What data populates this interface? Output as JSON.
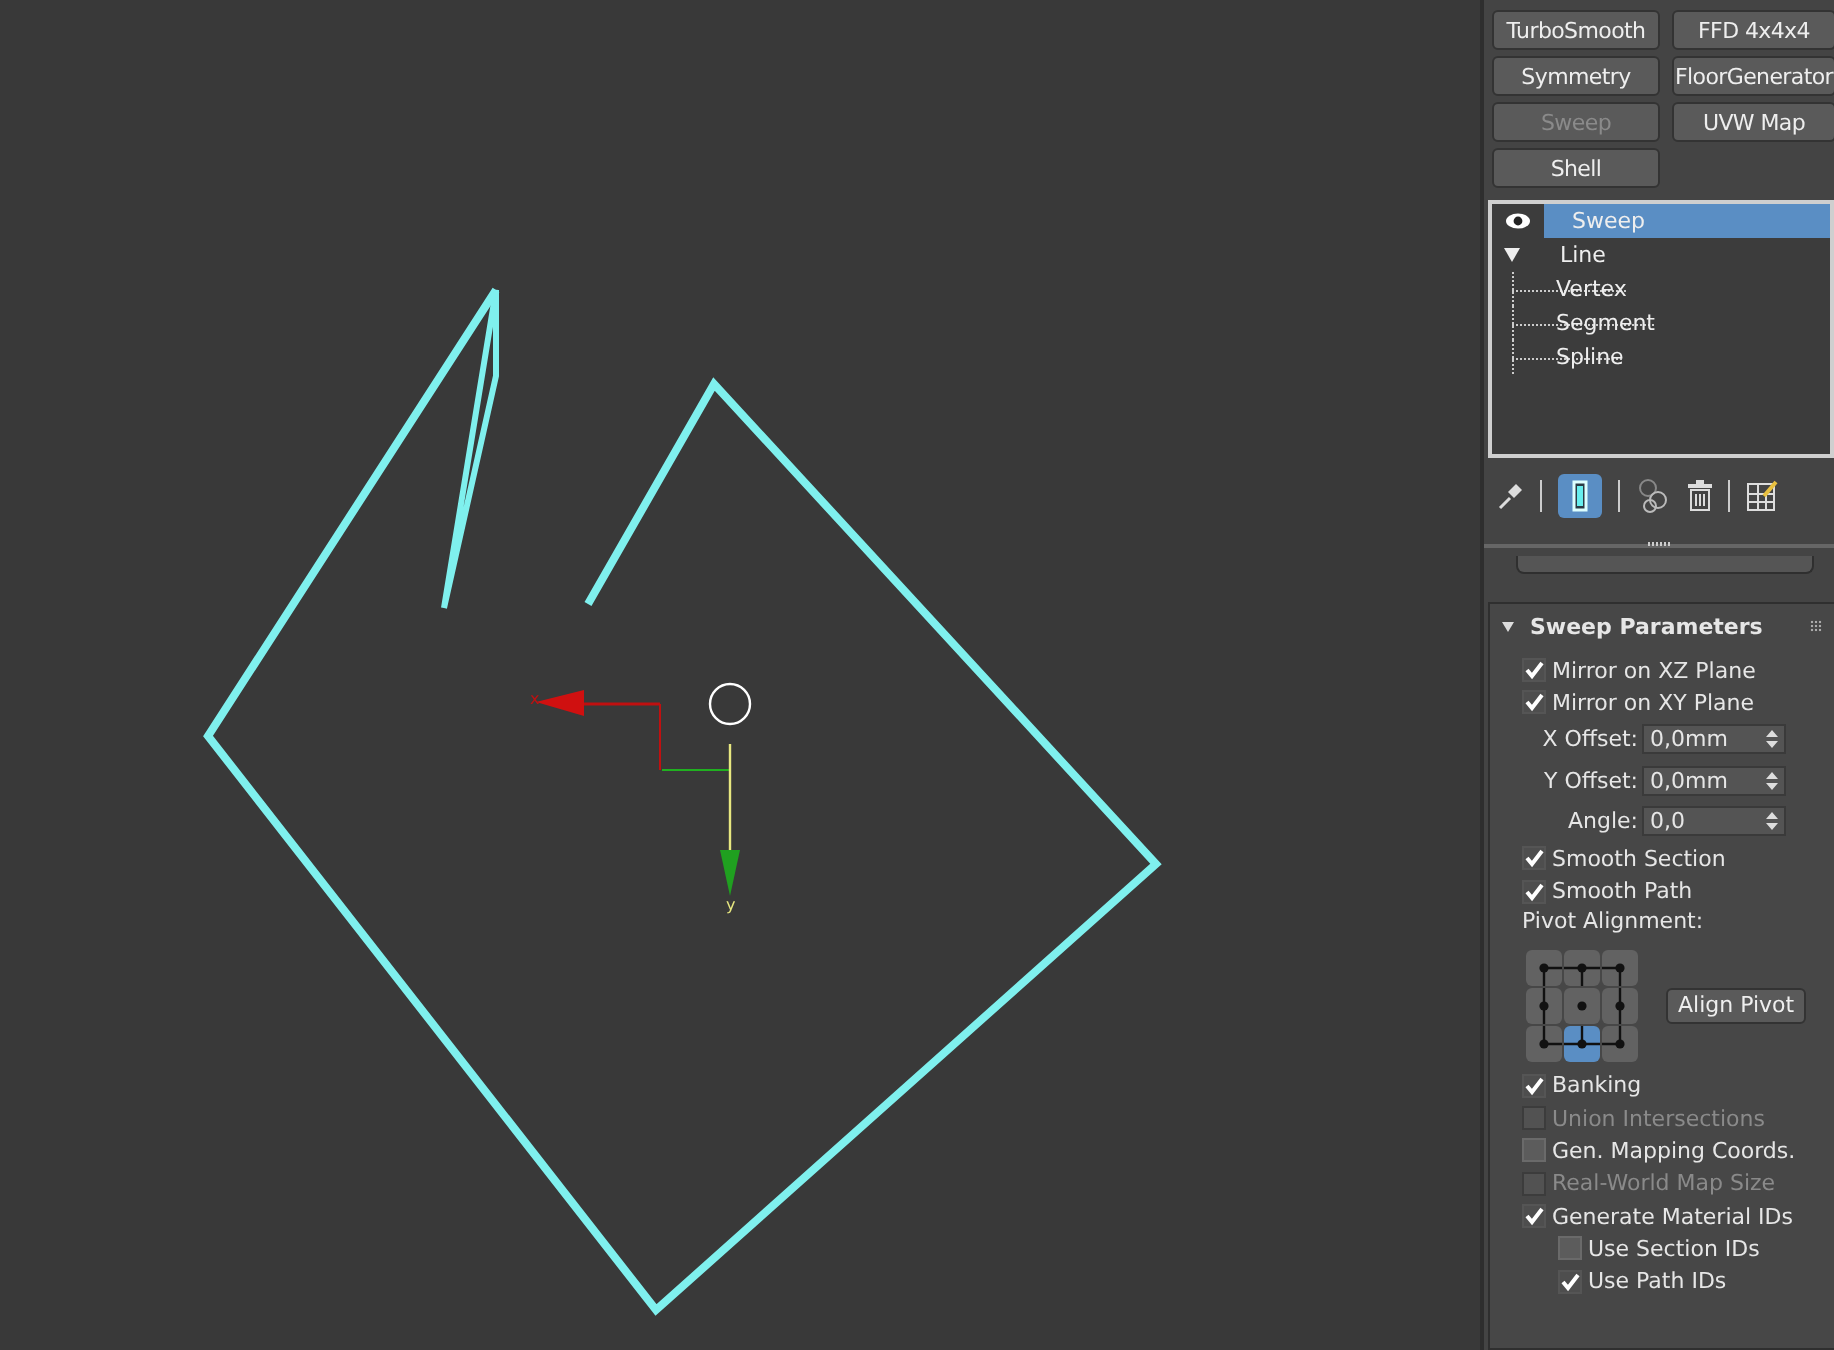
{
  "modifier_buttons": [
    {
      "label": "TurboSmooth",
      "disabled": false
    },
    {
      "label": "FFD 4x4x4",
      "disabled": false
    },
    {
      "label": "Symmetry",
      "disabled": false
    },
    {
      "label": "FloorGenerator",
      "disabled": false
    },
    {
      "label": "Sweep",
      "disabled": true
    },
    {
      "label": "UVW Map",
      "disabled": false
    },
    {
      "label": "Shell",
      "disabled": false
    }
  ],
  "modifier_stack": [
    {
      "label": "Sweep",
      "selected": true,
      "visible": true
    },
    {
      "label": "Line",
      "selected": false,
      "expanded": true,
      "children": [
        {
          "label": "Vertex",
          "selected": false
        },
        {
          "label": "Segment",
          "selected": false
        },
        {
          "label": "Spline",
          "selected": false
        }
      ]
    }
  ],
  "stack_toolbar": [
    {
      "kind": "pin",
      "on": false
    },
    {
      "kind": "end-result",
      "on": true
    },
    {
      "kind": "unique",
      "on": false
    },
    {
      "kind": "remove",
      "on": false
    },
    {
      "kind": "configure",
      "on": false
    }
  ],
  "rollout": {
    "title": "Sweep Parameters",
    "expanded": true,
    "rows": [
      {
        "kind": "checkbox",
        "label": "Mirror on XZ Plane",
        "checked": true,
        "disabled": false
      },
      {
        "kind": "checkbox",
        "label": "Mirror on XY Plane",
        "checked": true,
        "disabled": false
      },
      {
        "kind": "spinner",
        "label": "X Offset:",
        "value": "0,0mm"
      },
      {
        "kind": "spinner",
        "label": "Y Offset:",
        "value": "0,0mm"
      },
      {
        "kind": "spinner",
        "label": "Angle:",
        "value": "0,0"
      },
      {
        "kind": "checkbox",
        "label": "Smooth Section",
        "checked": true,
        "disabled": false
      },
      {
        "kind": "checkbox",
        "label": "Smooth Path",
        "checked": true,
        "disabled": false
      },
      {
        "kind": "label",
        "label": "Pivot Alignment:"
      },
      {
        "kind": "pivot",
        "cells": [
          {
            "selected": false
          },
          {
            "selected": false
          },
          {
            "selected": false
          },
          {
            "selected": false
          },
          {
            "selected": false
          },
          {
            "selected": false
          },
          {
            "selected": false
          },
          {
            "selected": true
          },
          {
            "selected": false
          }
        ],
        "button": "Align Pivot"
      },
      {
        "kind": "checkbox",
        "label": "Banking",
        "checked": true,
        "disabled": false
      },
      {
        "kind": "checkbox",
        "label": "Union Intersections",
        "checked": false,
        "disabled": true
      },
      {
        "kind": "checkbox",
        "label": "Gen. Mapping Coords.",
        "checked": false,
        "disabled": false
      },
      {
        "kind": "checkbox",
        "label": "Real-World Map Size",
        "checked": false,
        "disabled": true
      },
      {
        "kind": "checkbox",
        "label": "Generate Material IDs",
        "checked": true,
        "disabled": false,
        "children": [
          {
            "kind": "checkbox",
            "label": "Use Section IDs",
            "checked": false,
            "disabled": false
          },
          {
            "kind": "checkbox",
            "label": "Use Path IDs",
            "checked": true,
            "disabled": false
          }
        ]
      }
    ]
  },
  "viewport": {
    "gizmo_labels": [
      "x",
      "y"
    ]
  }
}
